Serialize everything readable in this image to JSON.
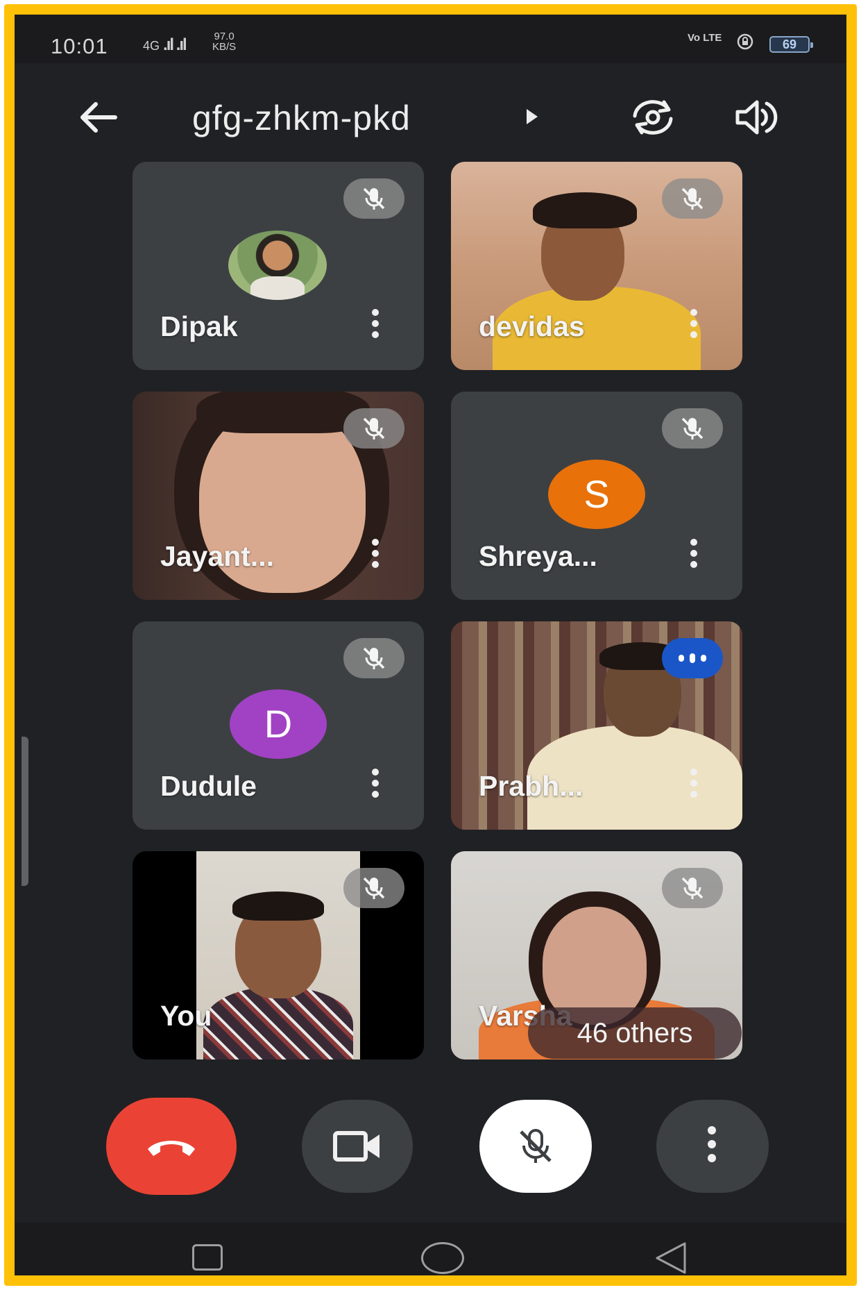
{
  "status_bar": {
    "time": "10:01",
    "network": "4G",
    "speed_value": "97.0",
    "speed_unit": "KB/S",
    "volte": "Vo LTE",
    "battery": "69"
  },
  "header": {
    "meeting_code": "gfg-zhkm-pkd"
  },
  "participants": [
    {
      "name": "Dipak",
      "avatar": "photo",
      "muted": true
    },
    {
      "name": "devidas",
      "video": true,
      "muted": true
    },
    {
      "name": "Jayant...",
      "video": true,
      "muted": true
    },
    {
      "name": "Shreya...",
      "avatar_letter": "S",
      "avatar_color": "#e8710a",
      "muted": true
    },
    {
      "name": "Dudule",
      "avatar_letter": "D",
      "avatar_color": "#a142c4",
      "muted": true
    },
    {
      "name": "Prabh...",
      "video": true,
      "speaking": true
    },
    {
      "name": "You",
      "video": true,
      "muted": true
    },
    {
      "name": "Varsha",
      "video": true,
      "muted": true
    }
  ],
  "others_count_label": "46 others",
  "colors": {
    "frame": "#ffc107",
    "background": "#202124",
    "tile": "#3c4043",
    "end_call": "#ea4335",
    "speaking_badge": "#1a56c8"
  },
  "controls": {
    "end_call_icon": "call-end-icon",
    "camera_icon": "videocam-icon",
    "mic_icon": "mic-off-icon",
    "more_icon": "more-vert-icon"
  }
}
